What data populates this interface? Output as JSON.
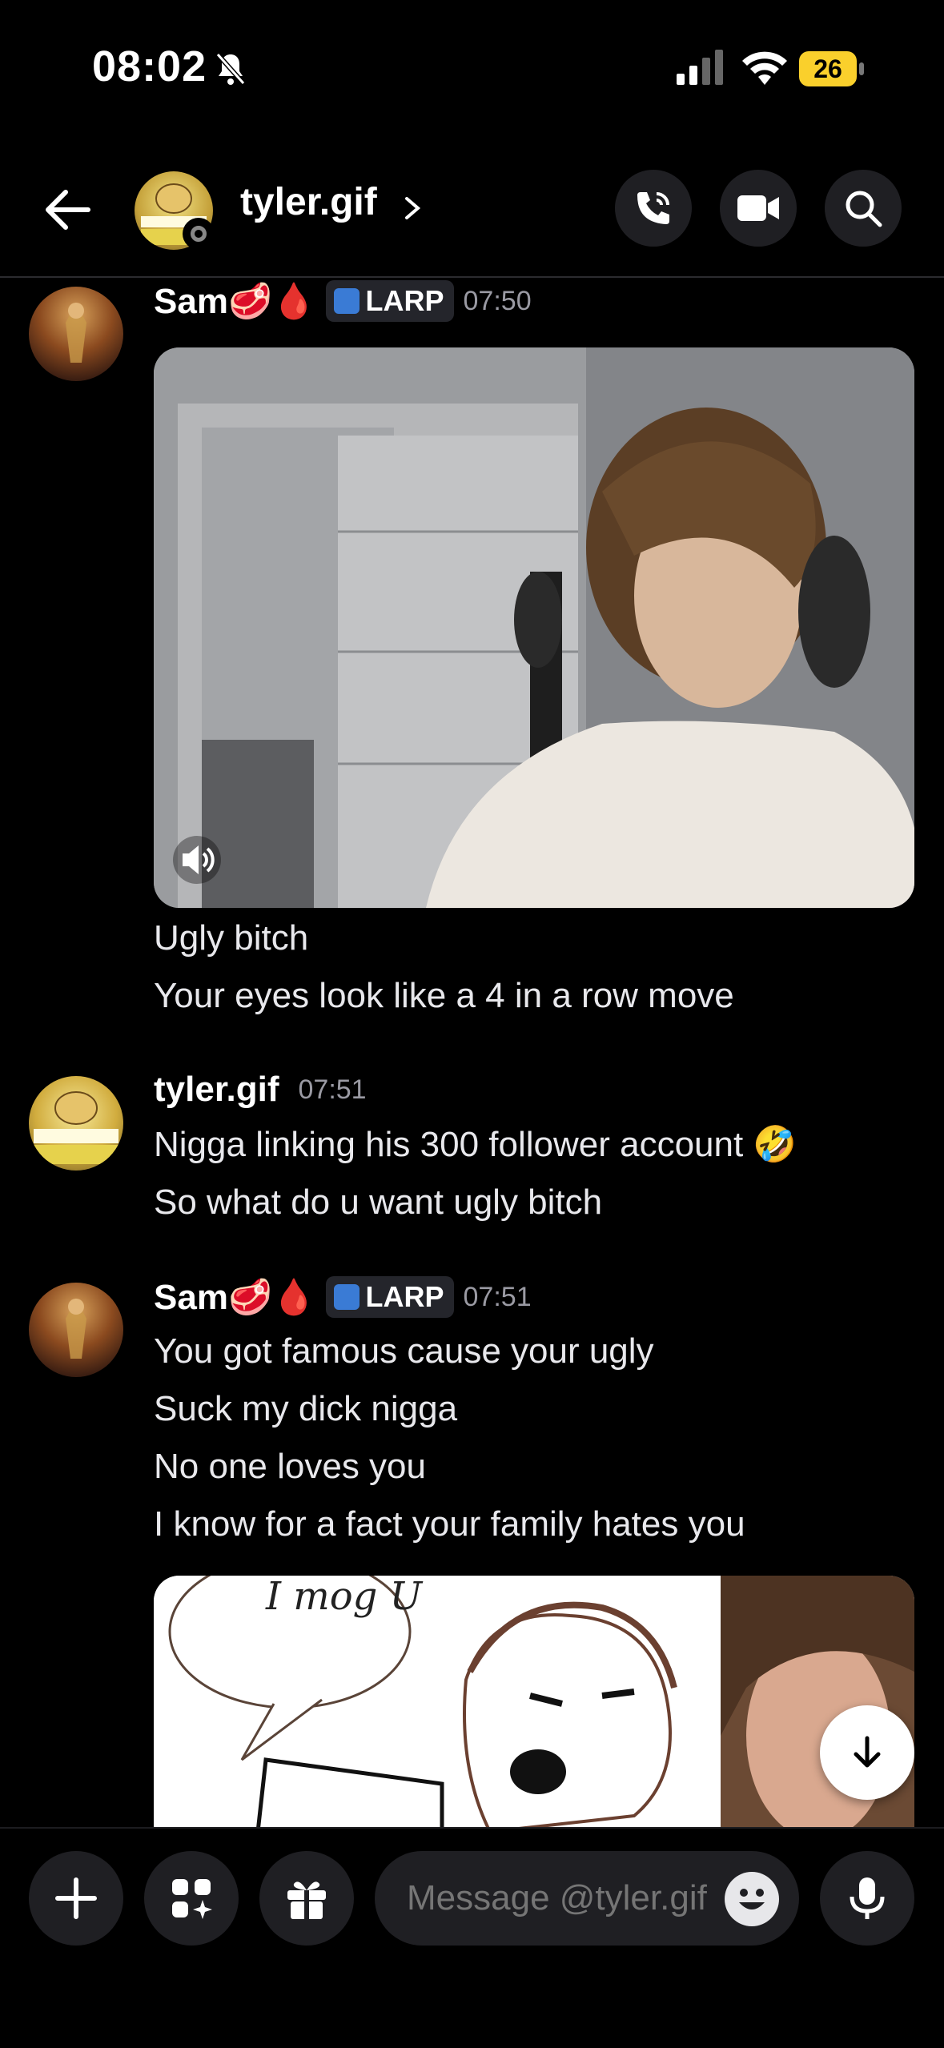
{
  "status_bar": {
    "time": "08:02",
    "battery": "26"
  },
  "header": {
    "title": "tyler.gif"
  },
  "messages": [
    {
      "author": "Sam🥩🩸",
      "tag": "LARP",
      "time": "07:50",
      "lines": [
        "Ugly bitch",
        "Your eyes look like a 4 in a row move"
      ]
    },
    {
      "author": "tyler.gif",
      "time": "07:51",
      "lines": [
        "Nigga linking his 300 follower account 🤣",
        "So what do u want ugly bitch"
      ]
    },
    {
      "author": "Sam🥩🩸",
      "tag": "LARP",
      "time": "07:51",
      "lines": [
        "You got famous cause your ugly",
        "Suck my dick nigga",
        "No one loves you",
        "I know for a fact your family hates you"
      ]
    }
  ],
  "drawing_caption": "I mog U",
  "composer": {
    "placeholder": "Message @tyler.gif"
  },
  "icons": [
    "bell-off-icon",
    "signal-icon",
    "wifi-icon",
    "back-arrow-icon",
    "phone-icon",
    "video-icon",
    "search-icon",
    "speaker-icon",
    "plus-icon",
    "apps-icon",
    "gift-icon",
    "emoji-icon",
    "mic-icon",
    "arrow-down-icon"
  ]
}
